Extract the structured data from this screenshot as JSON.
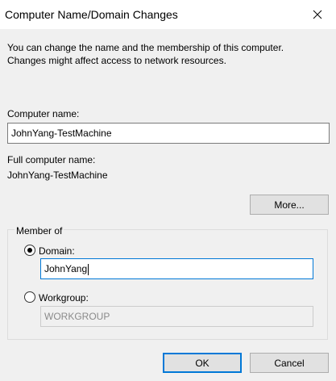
{
  "window": {
    "title": "Computer Name/Domain Changes",
    "close_icon": "close-icon"
  },
  "description": {
    "line1": "You can change the name and the membership of this computer.",
    "line2": "Changes might affect access to network resources."
  },
  "computer_name": {
    "label": "Computer name:",
    "value": "JohnYang-TestMachine"
  },
  "full_computer_name": {
    "label": "Full computer name:",
    "value": "JohnYang-TestMachine"
  },
  "more_button": "More...",
  "member_of": {
    "legend": "Member of",
    "domain": {
      "label": "Domain:",
      "selected": true,
      "value": "JohnYang"
    },
    "workgroup": {
      "label": "Workgroup:",
      "selected": false,
      "value": "WORKGROUP"
    }
  },
  "buttons": {
    "ok": "OK",
    "cancel": "Cancel"
  },
  "colors": {
    "focus_border": "#0078d7",
    "dialog_bg": "#f0f0f0"
  }
}
